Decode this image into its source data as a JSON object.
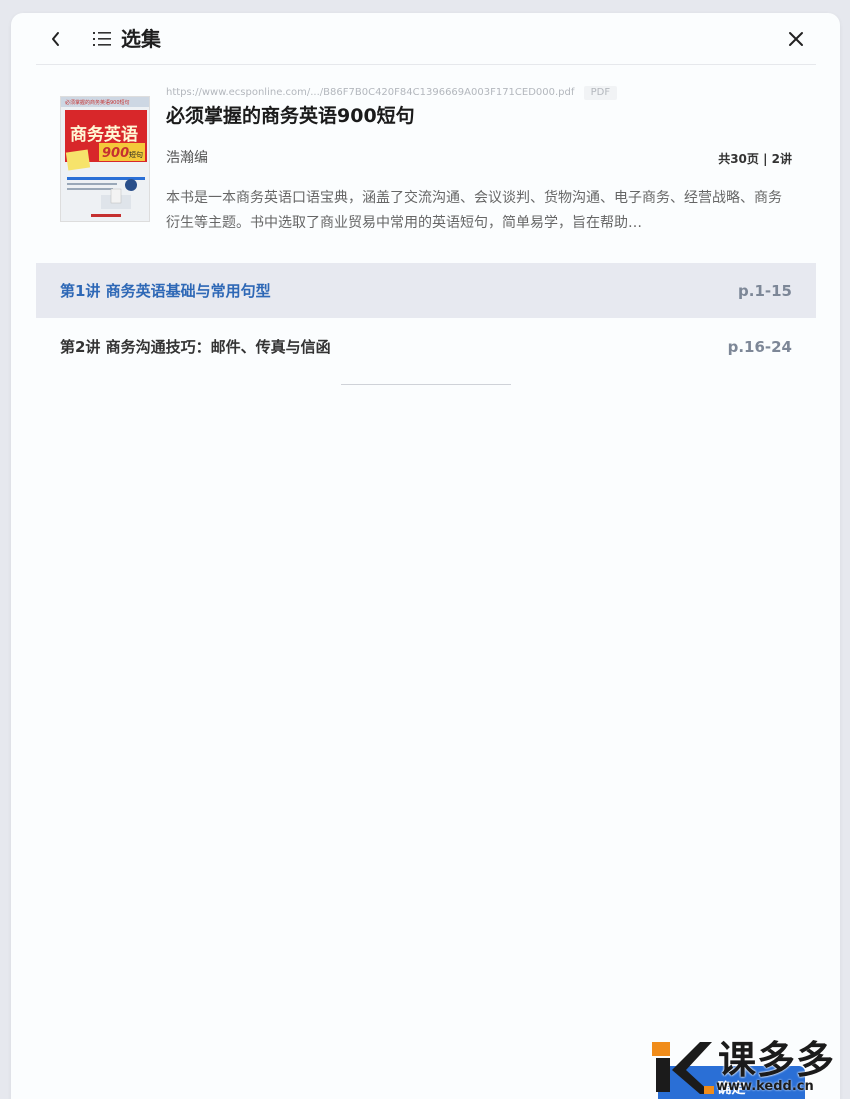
{
  "header": {
    "title": "选集",
    "back_icon": "chevron-left-icon",
    "list_icon": "list-icon",
    "close_icon": "close-icon"
  },
  "book": {
    "url": "https://www.ecsponline.com/.../B86F7B0C420F84C1396669A003F171CED000.pdf",
    "format_tag": "PDF",
    "title": "必须掌握的商务英语900短句",
    "author": "浩瀚编",
    "meta": "共30页 | 2讲",
    "description": "本书是一本商务英语口语宝典，涵盖了交流沟通、会议谈判、货物沟通、电子商务、经营战略、商务衍生等主题。书中选取了商业贸易中常用的英语短句，简单易学，旨在帮助…",
    "cover": {
      "top_text": "必须掌握的商务英语900短句",
      "big_title": "商务英语",
      "big_number": "900",
      "suffix": "短句"
    }
  },
  "episodes": [
    {
      "title": "第1讲 商务英语基础与常用句型",
      "pages": "p.1-15",
      "active": true
    },
    {
      "title": "第2讲 商务沟通技巧：邮件、传真与信函",
      "pages": "p.16-24",
      "active": false
    }
  ],
  "footer": {
    "confirm_label": "确定"
  },
  "watermark": {
    "text": "课多多",
    "url": "www.kedd.cn"
  },
  "colors": {
    "accent": "#2e68b6",
    "active_row_bg": "#e7e9f0",
    "button": "#2a6fd6"
  }
}
